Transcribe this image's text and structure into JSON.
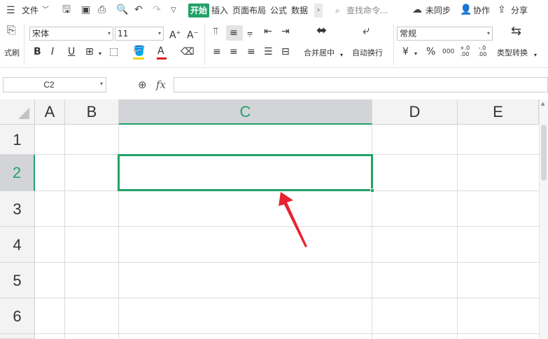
{
  "menu": {
    "file": "文件",
    "start": "开始",
    "tabs": [
      "插入",
      "页面布局",
      "公式",
      "数据"
    ],
    "search_placeholder": "查找命令...",
    "sync": "未同步",
    "collab": "协作",
    "share": "分享"
  },
  "ribbon": {
    "format_painter": "式刷",
    "font_name": "宋体",
    "font_size": "11",
    "merge_center": "合并居中",
    "wrap_text": "自动换行",
    "number_format": "常规",
    "type_convert": "类型转换",
    "currency_symbol": "¥",
    "percent_symbol": "%",
    "thousands_symbol": "000",
    "inc_decimal": "+.0 .00",
    "dec_decimal": "-.0 .00"
  },
  "formula_bar": {
    "name_box": "C2",
    "fx_label": "fx",
    "formula": ""
  },
  "grid": {
    "columns": [
      "A",
      "B",
      "C",
      "D",
      "E"
    ],
    "rows": [
      "1",
      "2",
      "3",
      "4",
      "5",
      "6"
    ],
    "selected_cell": "C2",
    "accent": "#21a366",
    "annotation_color": "#e8232f"
  }
}
